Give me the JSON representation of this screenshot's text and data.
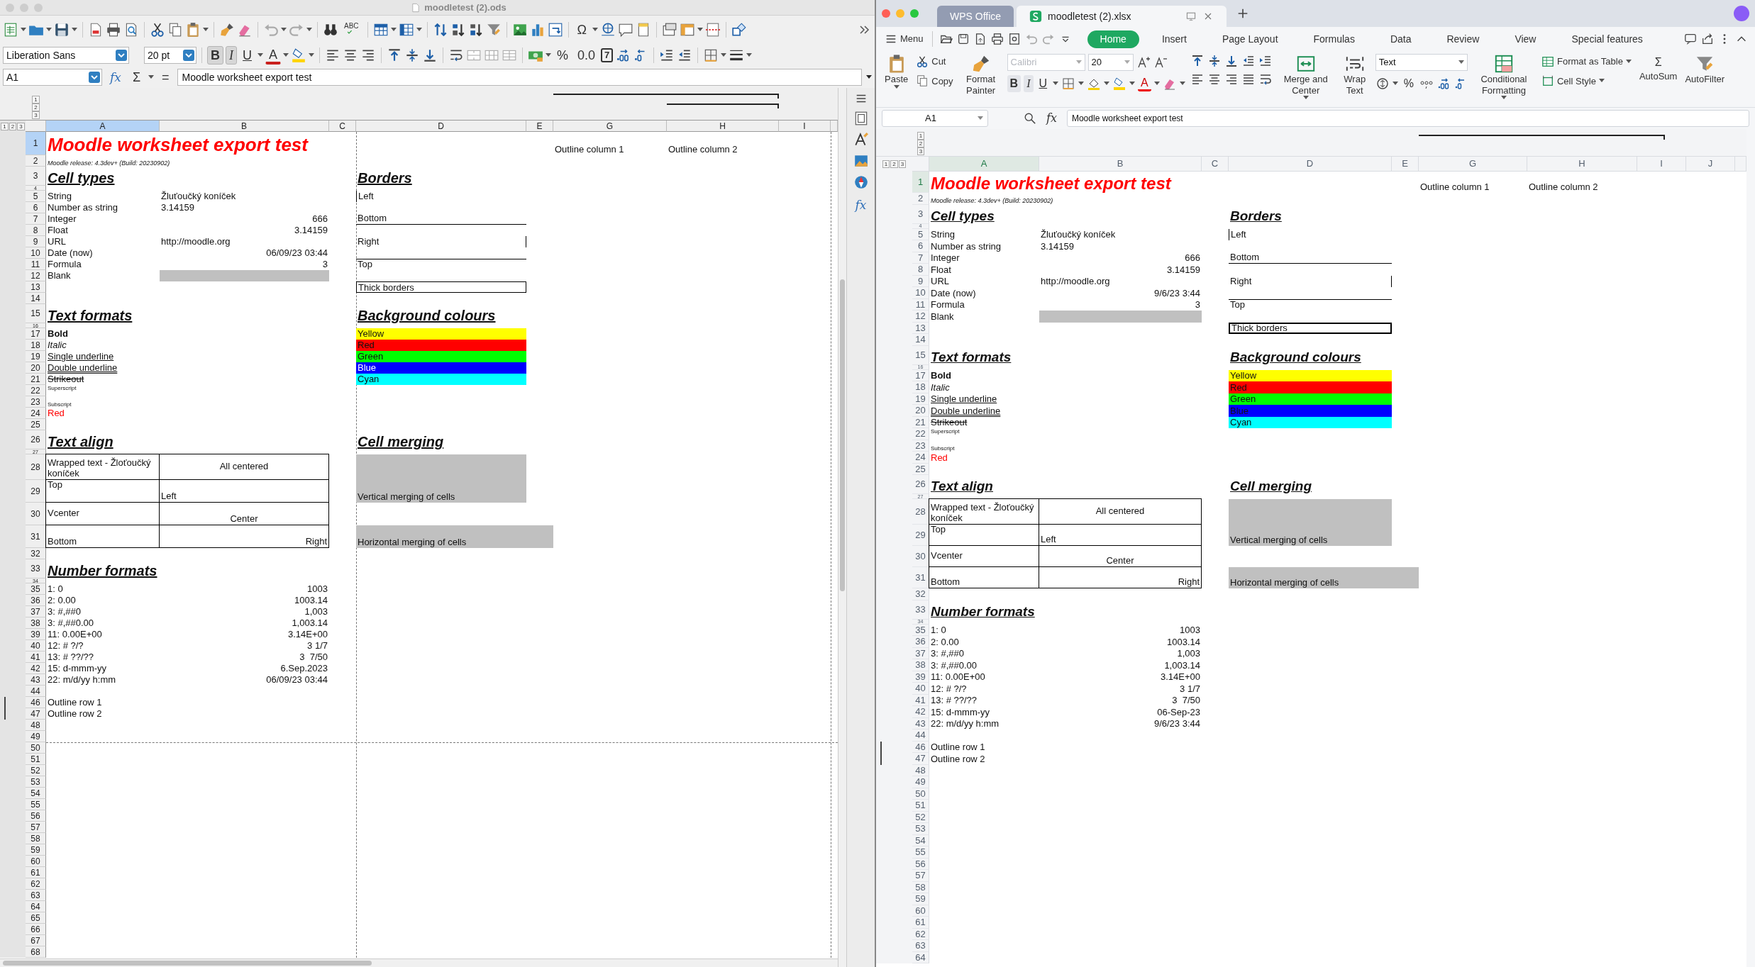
{
  "panes": [
    {
      "kind": "libreoffice",
      "title": "moodletest (2).ods",
      "glyphs": {
        "spelling": "ABC",
        "special_char": "Ω",
        "font_color": "A",
        "percent": "%",
        "number": "0.0",
        "calendar": "7"
      },
      "font_name": "Liberation Sans",
      "font_size": "20 pt",
      "format_buttons": [
        {
          "kind": "bold",
          "label": "B",
          "active": true
        },
        {
          "kind": "italic",
          "label": "I",
          "active": true
        },
        {
          "kind": "underline",
          "label": "U",
          "active": false
        }
      ],
      "name_box": "A1",
      "formula_symbols": [
        "fx",
        "Σ",
        "="
      ],
      "formula": "Moodle worksheet export test",
      "sidebar_fx": "fx",
      "outline_levels": [
        "1",
        "2",
        "3"
      ],
      "row_outline_levels": [
        "1",
        "2",
        "3"
      ],
      "columns": [
        {
          "label": "A",
          "selected": true
        },
        {
          "label": "B",
          "selected": false
        },
        {
          "label": "C",
          "selected": false
        },
        {
          "label": "D",
          "selected": false
        },
        {
          "label": "E",
          "selected": false
        },
        {
          "label": "G",
          "selected": false
        },
        {
          "label": "H",
          "selected": false
        },
        {
          "label": "I",
          "selected": false
        }
      ],
      "rows": [
        {
          "label": "1",
          "selected": true,
          "grouped": false,
          "page_break": false,
          "cells": {
            "col_a": {
              "kind": "title",
              "text": "Moodle worksheet export test"
            },
            "col_g": {
              "kind": "text",
              "text": "Outline column 1"
            },
            "col_h": {
              "kind": "text",
              "text": "Outline column 2"
            }
          }
        },
        {
          "label": "2",
          "selected": false,
          "grouped": false,
          "page_break": false,
          "cells": {
            "col_a": {
              "kind": "note",
              "text": "Moodle release: 4.3dev+ (Build: 20230902)"
            }
          }
        },
        {
          "label": "3",
          "selected": false,
          "grouped": false,
          "page_break": false,
          "cells": {
            "col_a": {
              "kind": "heading",
              "text": "Cell types"
            },
            "col_d": {
              "kind": "heading",
              "text": "Borders"
            }
          }
        },
        {
          "label": "4",
          "selected": false,
          "grouped": false,
          "page_break": false
        },
        {
          "label": "5",
          "selected": false,
          "grouped": false,
          "page_break": false,
          "cells": {
            "col_a": {
              "kind": "text",
              "text": "String"
            },
            "col_b": {
              "kind": "text",
              "text": "Žluťoučký koníček"
            },
            "col_d": {
              "kind": "border_left",
              "text": "Left"
            }
          }
        },
        {
          "label": "6",
          "selected": false,
          "grouped": false,
          "page_break": false,
          "cells": {
            "col_a": {
              "kind": "text",
              "text": "Number as string"
            },
            "col_b": {
              "kind": "text",
              "text": "3.14159"
            }
          }
        },
        {
          "label": "7",
          "selected": false,
          "grouped": false,
          "page_break": false,
          "cells": {
            "col_a": {
              "kind": "text",
              "text": "Integer"
            },
            "col_b": {
              "kind": "number",
              "text": "666"
            },
            "col_d": {
              "kind": "border_bottom",
              "text": "Bottom"
            }
          }
        },
        {
          "label": "8",
          "selected": false,
          "grouped": false,
          "page_break": false,
          "cells": {
            "col_a": {
              "kind": "text",
              "text": "Float"
            },
            "col_b": {
              "kind": "number",
              "text": "3.14159"
            }
          }
        },
        {
          "label": "9",
          "selected": false,
          "grouped": false,
          "page_break": false,
          "cells": {
            "col_a": {
              "kind": "text",
              "text": "URL"
            },
            "col_b": {
              "kind": "text",
              "text": "http://moodle.org"
            },
            "col_d": {
              "kind": "border_right",
              "text": "Right"
            }
          }
        },
        {
          "label": "10",
          "selected": false,
          "grouped": false,
          "page_break": false,
          "cells": {
            "col_a": {
              "kind": "text",
              "text": "Date (now)"
            },
            "col_b": {
              "kind": "number",
              "text": "06/09/23 03:44"
            }
          }
        },
        {
          "label": "11",
          "selected": false,
          "grouped": false,
          "page_break": false,
          "cells": {
            "col_a": {
              "kind": "text",
              "text": "Formula"
            },
            "col_b": {
              "kind": "number",
              "text": "3"
            },
            "col_d": {
              "kind": "border_top",
              "text": "Top"
            }
          }
        },
        {
          "label": "12",
          "selected": false,
          "grouped": false,
          "page_break": false,
          "cells": {
            "col_a": {
              "kind": "text",
              "text": "Blank"
            },
            "col_b": {
              "kind": "fill",
              "color": "#c0c0c0"
            }
          }
        },
        {
          "label": "13",
          "selected": false,
          "grouped": false,
          "page_break": false,
          "cells": {
            "col_d": {
              "kind": "border_box",
              "text": "Thick borders"
            }
          }
        },
        {
          "label": "14",
          "selected": false,
          "grouped": false,
          "page_break": false
        },
        {
          "label": "15",
          "selected": false,
          "grouped": false,
          "page_break": false,
          "cells": {
            "col_a": {
              "kind": "heading",
              "text": "Text formats"
            },
            "col_d": {
              "kind": "heading",
              "text": "Background colours"
            }
          }
        },
        {
          "label": "16",
          "selected": false,
          "grouped": false,
          "page_break": false
        },
        {
          "label": "17",
          "selected": false,
          "grouped": false,
          "page_break": false,
          "cells": {
            "col_a": {
              "kind": "bold",
              "text": "Bold"
            },
            "col_d": {
              "kind": "fill",
              "text": "Yellow",
              "color": "#ffff00"
            }
          }
        },
        {
          "label": "18",
          "selected": false,
          "grouped": false,
          "page_break": false,
          "cells": {
            "col_a": {
              "kind": "italic",
              "text": "Italic"
            },
            "col_d": {
              "kind": "fill",
              "text": "Red",
              "color": "#ff0000"
            }
          }
        },
        {
          "label": "19",
          "selected": false,
          "grouped": false,
          "page_break": false,
          "cells": {
            "col_a": {
              "kind": "underline",
              "text": "Single underline"
            },
            "col_d": {
              "kind": "fill",
              "text": "Green",
              "color": "#00ff00"
            }
          }
        },
        {
          "label": "20",
          "selected": false,
          "grouped": false,
          "page_break": false,
          "cells": {
            "col_a": {
              "kind": "double_underline",
              "text": "Double underline"
            },
            "col_d": {
              "kind": "fill_inverse",
              "text": "Blue",
              "color": "#0000ff"
            }
          }
        },
        {
          "label": "21",
          "selected": false,
          "grouped": false,
          "page_break": false,
          "cells": {
            "col_a": {
              "kind": "strike",
              "text": "Strikeout"
            },
            "col_d": {
              "kind": "fill",
              "text": "Cyan",
              "color": "#00ffff"
            }
          }
        },
        {
          "label": "22",
          "selected": false,
          "grouped": false,
          "page_break": false,
          "cells": {
            "col_a": {
              "kind": "superscript",
              "text": "Superscript"
            }
          }
        },
        {
          "label": "23",
          "selected": false,
          "grouped": false,
          "page_break": false,
          "cells": {
            "col_a": {
              "kind": "subscript",
              "text": "Subscript"
            }
          }
        },
        {
          "label": "24",
          "selected": false,
          "grouped": false,
          "page_break": false,
          "cells": {
            "col_a": {
              "kind": "red",
              "text": "Red"
            }
          }
        },
        {
          "label": "25",
          "selected": false,
          "grouped": false,
          "page_break": false
        },
        {
          "label": "26",
          "selected": false,
          "grouped": false,
          "page_break": false,
          "cells": {
            "col_a": {
              "kind": "heading",
              "text": "Text align"
            },
            "col_d": {
              "kind": "heading",
              "text": "Cell merging"
            }
          }
        },
        {
          "label": "27",
          "selected": false,
          "grouped": false,
          "page_break": false
        },
        {
          "label": "28",
          "selected": false,
          "grouped": false,
          "page_break": false,
          "cells": {
            "col_a": {
              "kind": "table_wrap",
              "text": "Wrapped text - Žloťoučký koníček"
            },
            "col_b": {
              "kind": "table_center_middle",
              "text": "All centered"
            },
            "col_d": {
              "kind": "merge_down",
              "text": "Vertical merging of cells",
              "color": "#c0c0c0"
            }
          }
        },
        {
          "label": "29",
          "selected": false,
          "grouped": false,
          "page_break": false,
          "cells": {
            "col_a": {
              "kind": "table_top",
              "text": "Top"
            },
            "col_b": {
              "kind": "table_bottom",
              "text": "Left"
            }
          }
        },
        {
          "label": "30",
          "selected": false,
          "grouped": false,
          "page_break": false,
          "cells": {
            "col_a": {
              "kind": "table_middle",
              "text": "Vcenter"
            },
            "col_b": {
              "kind": "table_center",
              "text": "Center"
            }
          }
        },
        {
          "label": "31",
          "selected": false,
          "grouped": false,
          "page_break": false,
          "cells": {
            "col_a": {
              "kind": "table_bottom",
              "text": "Bottom"
            },
            "col_b": {
              "kind": "table_right",
              "text": "Right"
            },
            "col_d": {
              "kind": "merge_across",
              "text": "Horizontal merging of cells",
              "color": "#c0c0c0"
            }
          }
        },
        {
          "label": "32",
          "selected": false,
          "grouped": false,
          "page_break": false
        },
        {
          "label": "33",
          "selected": false,
          "grouped": false,
          "page_break": false,
          "cells": {
            "col_a": {
              "kind": "heading",
              "text": "Number formats"
            }
          }
        },
        {
          "label": "34",
          "selected": false,
          "grouped": false,
          "page_break": false
        },
        {
          "label": "35",
          "selected": false,
          "grouped": false,
          "page_break": false,
          "cells": {
            "col_a": {
              "kind": "text",
              "text": "1: 0"
            },
            "col_b": {
              "kind": "number",
              "text": "1003"
            }
          }
        },
        {
          "label": "36",
          "selected": false,
          "grouped": false,
          "page_break": false,
          "cells": {
            "col_a": {
              "kind": "text",
              "text": "2: 0.00"
            },
            "col_b": {
              "kind": "number",
              "text": "1003.14"
            }
          }
        },
        {
          "label": "37",
          "selected": false,
          "grouped": false,
          "page_break": false,
          "cells": {
            "col_a": {
              "kind": "text",
              "text": "3: #,##0"
            },
            "col_b": {
              "kind": "number",
              "text": "1,003"
            }
          }
        },
        {
          "label": "38",
          "selected": false,
          "grouped": false,
          "page_break": false,
          "cells": {
            "col_a": {
              "kind": "text",
              "text": "3: #,##0.00"
            },
            "col_b": {
              "kind": "number",
              "text": "1,003.14"
            }
          }
        },
        {
          "label": "39",
          "selected": false,
          "grouped": false,
          "page_break": false,
          "cells": {
            "col_a": {
              "kind": "text",
              "text": "11: 0.00E+00"
            },
            "col_b": {
              "kind": "number",
              "text": "3.14E+00"
            }
          }
        },
        {
          "label": "40",
          "selected": false,
          "grouped": false,
          "page_break": false,
          "cells": {
            "col_a": {
              "kind": "text",
              "text": "12: # ?/?"
            },
            "col_b": {
              "kind": "number",
              "text": "3 1/7"
            }
          }
        },
        {
          "label": "41",
          "selected": false,
          "grouped": false,
          "page_break": false,
          "cells": {
            "col_a": {
              "kind": "text",
              "text": "13: # ??/??"
            },
            "col_b": {
              "kind": "number",
              "text": "3  7/50"
            }
          }
        },
        {
          "label": "42",
          "selected": false,
          "grouped": false,
          "page_break": false,
          "cells": {
            "col_a": {
              "kind": "text",
              "text": "15: d-mmm-yy"
            },
            "col_b": {
              "kind": "number",
              "text": "6.Sep.2023"
            }
          }
        },
        {
          "label": "43",
          "selected": false,
          "grouped": false,
          "page_break": false,
          "cells": {
            "col_a": {
              "kind": "text",
              "text": "22: m/d/yy h:mm"
            },
            "col_b": {
              "kind": "number",
              "text": "06/09/23 03:44"
            }
          }
        },
        {
          "label": "44",
          "selected": false,
          "grouped": false,
          "page_break": false
        },
        {
          "label": "46",
          "selected": false,
          "grouped": true,
          "page_break": false,
          "cells": {
            "col_a": {
              "kind": "text",
              "text": "Outline row 1"
            }
          }
        },
        {
          "label": "47",
          "selected": false,
          "grouped": true,
          "page_break": false,
          "cells": {
            "col_a": {
              "kind": "text",
              "text": "Outline row 2"
            }
          }
        },
        {
          "label": "48",
          "selected": false,
          "grouped": false,
          "page_break": false
        },
        {
          "label": "49",
          "selected": false,
          "grouped": false,
          "page_break": false
        },
        {
          "label": "50",
          "selected": false,
          "grouped": false,
          "page_break": true
        },
        {
          "label": "51",
          "selected": false,
          "grouped": false,
          "page_break": false
        },
        {
          "label": "52",
          "selected": false,
          "grouped": false,
          "page_break": false
        },
        {
          "label": "53",
          "selected": false,
          "grouped": false,
          "page_break": false
        },
        {
          "label": "54",
          "selected": false,
          "grouped": false,
          "page_break": false
        },
        {
          "label": "55",
          "selected": false,
          "grouped": false,
          "page_break": false
        },
        {
          "label": "56",
          "selected": false,
          "grouped": false,
          "page_break": false
        },
        {
          "label": "57",
          "selected": false,
          "grouped": false,
          "page_break": false
        },
        {
          "label": "58",
          "selected": false,
          "grouped": false,
          "page_break": false
        },
        {
          "label": "59",
          "selected": false,
          "grouped": false,
          "page_break": false
        },
        {
          "label": "60",
          "selected": false,
          "grouped": false,
          "page_break": false
        },
        {
          "label": "61",
          "selected": false,
          "grouped": false,
          "page_break": false
        },
        {
          "label": "62",
          "selected": false,
          "grouped": false,
          "page_break": false
        },
        {
          "label": "63",
          "selected": false,
          "grouped": false,
          "page_break": false
        },
        {
          "label": "64",
          "selected": false,
          "grouped": false,
          "page_break": false
        },
        {
          "label": "65",
          "selected": false,
          "grouped": false,
          "page_break": false
        },
        {
          "label": "66",
          "selected": false,
          "grouped": false,
          "page_break": false
        },
        {
          "label": "67",
          "selected": false,
          "grouped": false,
          "page_break": false
        },
        {
          "label": "68",
          "selected": false,
          "grouped": false,
          "page_break": false
        }
      ]
    },
    {
      "kind": "wps",
      "tabs": [
        {
          "label": "WPS Office",
          "selected": false
        },
        {
          "label": "moodletest (2).xlsx",
          "selected": true
        }
      ],
      "menu": "Menu",
      "ribbon_tabs": [
        {
          "label": "Home",
          "selected": true
        },
        {
          "label": "Insert",
          "selected": false
        },
        {
          "label": "Page Layout",
          "selected": false
        },
        {
          "label": "Formulas",
          "selected": false
        },
        {
          "label": "Data",
          "selected": false
        },
        {
          "label": "Review",
          "selected": false
        },
        {
          "label": "View",
          "selected": false
        },
        {
          "label": "Special features",
          "selected": false
        }
      ],
      "ribbon": {
        "paste": "Paste",
        "cut": "Cut",
        "copy": "Copy",
        "format_painter": "Format Painter",
        "merge": "Merge and Center",
        "wrap": "Wrap Text",
        "conditional": "Conditional Formatting",
        "format_table": "Format as Table",
        "cell_style": "Cell Style",
        "autosum": "AutoSum",
        "autofilter": "AutoFilter"
      },
      "font_name": {
        "value": "Calibri",
        "disabled": true
      },
      "font_size": "20",
      "format_buttons": [
        {
          "kind": "bold",
          "label": "B",
          "active": true
        },
        {
          "kind": "italic",
          "label": "I",
          "active": true
        },
        {
          "kind": "underline",
          "label": "U",
          "active": false
        }
      ],
      "glyphs": {
        "font_color": "A",
        "percent": "%",
        "sum": "Σ"
      },
      "number_format": "Text",
      "name_box": "A1",
      "formula_symbols": [
        "fx"
      ],
      "formula": "Moodle worksheet export test",
      "outline_levels": [
        "1",
        "2",
        "3"
      ],
      "row_outline_levels": [
        "1",
        "2",
        "3"
      ],
      "columns": [
        {
          "label": "A",
          "selected": true
        },
        {
          "label": "B",
          "selected": false
        },
        {
          "label": "C",
          "selected": false
        },
        {
          "label": "D",
          "selected": false
        },
        {
          "label": "E",
          "selected": false
        },
        {
          "label": "G",
          "selected": false
        },
        {
          "label": "H",
          "selected": false
        },
        {
          "label": "I",
          "selected": false
        },
        {
          "label": "J",
          "selected": false
        }
      ],
      "rows": [
        {
          "label": "1",
          "selected": true,
          "grouped": false,
          "cells": {
            "col_a": {
              "kind": "title",
              "text": "Moodle worksheet export test"
            },
            "col_g": {
              "kind": "text",
              "text": "Outline column 1"
            },
            "col_h": {
              "kind": "text",
              "text": "Outline column 2"
            }
          }
        },
        {
          "label": "2",
          "selected": false,
          "grouped": false,
          "cells": {
            "col_a": {
              "kind": "note",
              "text": "Moodle release: 4.3dev+ (Build: 20230902)"
            }
          }
        },
        {
          "label": "3",
          "selected": false,
          "grouped": false,
          "cells": {
            "col_a": {
              "kind": "heading",
              "text": "Cell types"
            },
            "col_d": {
              "kind": "heading",
              "text": "Borders"
            }
          }
        },
        {
          "label": "4",
          "selected": false,
          "grouped": false
        },
        {
          "label": "5",
          "selected": false,
          "grouped": false,
          "cells": {
            "col_a": {
              "kind": "text",
              "text": "String"
            },
            "col_b": {
              "kind": "text",
              "text": "Žluťoučký koníček"
            },
            "col_d": {
              "kind": "border_left",
              "text": "Left"
            }
          }
        },
        {
          "label": "6",
          "selected": false,
          "grouped": false,
          "cells": {
            "col_a": {
              "kind": "text",
              "text": "Number as string"
            },
            "col_b": {
              "kind": "text",
              "text": "3.14159"
            }
          }
        },
        {
          "label": "7",
          "selected": false,
          "grouped": false,
          "cells": {
            "col_a": {
              "kind": "text",
              "text": "Integer"
            },
            "col_b": {
              "kind": "number",
              "text": "666"
            },
            "col_d": {
              "kind": "border_bottom",
              "text": "Bottom"
            }
          }
        },
        {
          "label": "8",
          "selected": false,
          "grouped": false,
          "cells": {
            "col_a": {
              "kind": "text",
              "text": "Float"
            },
            "col_b": {
              "kind": "number",
              "text": "3.14159"
            }
          }
        },
        {
          "label": "9",
          "selected": false,
          "grouped": false,
          "cells": {
            "col_a": {
              "kind": "text",
              "text": "URL"
            },
            "col_b": {
              "kind": "text",
              "text": "http://moodle.org"
            },
            "col_d": {
              "kind": "border_right",
              "text": "Right"
            }
          }
        },
        {
          "label": "10",
          "selected": false,
          "grouped": false,
          "cells": {
            "col_a": {
              "kind": "text",
              "text": "Date (now)"
            },
            "col_b": {
              "kind": "number",
              "text": "9/6/23 3:44"
            }
          }
        },
        {
          "label": "11",
          "selected": false,
          "grouped": false,
          "cells": {
            "col_a": {
              "kind": "text",
              "text": "Formula"
            },
            "col_b": {
              "kind": "number",
              "text": "3"
            },
            "col_d": {
              "kind": "border_top",
              "text": "Top"
            }
          }
        },
        {
          "label": "12",
          "selected": false,
          "grouped": false,
          "cells": {
            "col_a": {
              "kind": "text",
              "text": "Blank"
            },
            "col_b": {
              "kind": "fill",
              "color": "#c0c0c0"
            }
          }
        },
        {
          "label": "13",
          "selected": false,
          "grouped": false,
          "cells": {
            "col_d": {
              "kind": "border_thick",
              "text": "Thick borders"
            }
          }
        },
        {
          "label": "14",
          "selected": false,
          "grouped": false
        },
        {
          "label": "15",
          "selected": false,
          "grouped": false,
          "cells": {
            "col_a": {
              "kind": "heading",
              "text": "Text formats"
            },
            "col_d": {
              "kind": "heading",
              "text": "Background colours"
            }
          }
        },
        {
          "label": "16",
          "selected": false,
          "grouped": false
        },
        {
          "label": "17",
          "selected": false,
          "grouped": false,
          "cells": {
            "col_a": {
              "kind": "bold",
              "text": "Bold"
            },
            "col_d": {
              "kind": "fill",
              "text": "Yellow",
              "color": "#ffff00"
            }
          }
        },
        {
          "label": "18",
          "selected": false,
          "grouped": false,
          "cells": {
            "col_a": {
              "kind": "italic",
              "text": "Italic"
            },
            "col_d": {
              "kind": "fill",
              "text": "Red",
              "color": "#ff0000"
            }
          }
        },
        {
          "label": "19",
          "selected": false,
          "grouped": false,
          "cells": {
            "col_a": {
              "kind": "underline",
              "text": "Single underline"
            },
            "col_d": {
              "kind": "fill",
              "text": "Green",
              "color": "#00ff00"
            }
          }
        },
        {
          "label": "20",
          "selected": false,
          "grouped": false,
          "cells": {
            "col_a": {
              "kind": "double_underline",
              "text": "Double underline"
            },
            "col_d": {
              "kind": "fill",
              "text": "Blue",
              "color": "#0000ff"
            }
          }
        },
        {
          "label": "21",
          "selected": false,
          "grouped": false,
          "cells": {
            "col_a": {
              "kind": "strike",
              "text": "Strikeout"
            },
            "col_d": {
              "kind": "fill",
              "text": "Cyan",
              "color": "#00ffff"
            }
          }
        },
        {
          "label": "22",
          "selected": false,
          "grouped": false,
          "cells": {
            "col_a": {
              "kind": "superscript",
              "text": "Superscript"
            }
          }
        },
        {
          "label": "23",
          "selected": false,
          "grouped": false,
          "cells": {
            "col_a": {
              "kind": "subscript",
              "text": "Subscript"
            }
          }
        },
        {
          "label": "24",
          "selected": false,
          "grouped": false,
          "cells": {
            "col_a": {
              "kind": "red",
              "text": "Red"
            }
          }
        },
        {
          "label": "25",
          "selected": false,
          "grouped": false
        },
        {
          "label": "26",
          "selected": false,
          "grouped": false,
          "cells": {
            "col_a": {
              "kind": "heading",
              "text": "Text align"
            },
            "col_d": {
              "kind": "heading",
              "text": "Cell merging"
            }
          }
        },
        {
          "label": "27",
          "selected": false,
          "grouped": false
        },
        {
          "label": "28",
          "selected": false,
          "grouped": false,
          "cells": {
            "col_a": {
              "kind": "table_wrap",
              "text": "Wrapped text - Žloťoučký koníček"
            },
            "col_b": {
              "kind": "table_center_middle",
              "text": "All centered"
            },
            "col_d": {
              "kind": "merge_down",
              "text": "Vertical merging of cells",
              "color": "#c0c0c0"
            }
          }
        },
        {
          "label": "29",
          "selected": false,
          "grouped": false,
          "cells": {
            "col_a": {
              "kind": "table_top",
              "text": "Top"
            },
            "col_b": {
              "kind": "table_bottom",
              "text": "Left"
            }
          }
        },
        {
          "label": "30",
          "selected": false,
          "grouped": false,
          "cells": {
            "col_a": {
              "kind": "table_middle",
              "text": "Vcenter"
            },
            "col_b": {
              "kind": "table_center",
              "text": "Center"
            }
          }
        },
        {
          "label": "31",
          "selected": false,
          "grouped": false,
          "cells": {
            "col_a": {
              "kind": "table_bottom",
              "text": "Bottom"
            },
            "col_b": {
              "kind": "table_right",
              "text": "Right"
            },
            "col_d": {
              "kind": "merge_across",
              "text": "Horizontal merging of cells",
              "color": "#c0c0c0"
            }
          }
        },
        {
          "label": "32",
          "selected": false,
          "grouped": false
        },
        {
          "label": "33",
          "selected": false,
          "grouped": false,
          "cells": {
            "col_a": {
              "kind": "heading",
              "text": "Number formats"
            }
          }
        },
        {
          "label": "34",
          "selected": false,
          "grouped": false
        },
        {
          "label": "35",
          "selected": false,
          "grouped": false,
          "cells": {
            "col_a": {
              "kind": "text",
              "text": "1: 0"
            },
            "col_b": {
              "kind": "number",
              "text": "1003"
            }
          }
        },
        {
          "label": "36",
          "selected": false,
          "grouped": false,
          "cells": {
            "col_a": {
              "kind": "text",
              "text": "2: 0.00"
            },
            "col_b": {
              "kind": "number",
              "text": "1003.14"
            }
          }
        },
        {
          "label": "37",
          "selected": false,
          "grouped": false,
          "cells": {
            "col_a": {
              "kind": "text",
              "text": "3: #,##0"
            },
            "col_b": {
              "kind": "number",
              "text": "1,003"
            }
          }
        },
        {
          "label": "38",
          "selected": false,
          "grouped": false,
          "cells": {
            "col_a": {
              "kind": "text",
              "text": "3: #,##0.00"
            },
            "col_b": {
              "kind": "number",
              "text": "1,003.14"
            }
          }
        },
        {
          "label": "39",
          "selected": false,
          "grouped": false,
          "cells": {
            "col_a": {
              "kind": "text",
              "text": "11: 0.00E+00"
            },
            "col_b": {
              "kind": "number",
              "text": "3.14E+00"
            }
          }
        },
        {
          "label": "40",
          "selected": false,
          "grouped": false,
          "cells": {
            "col_a": {
              "kind": "text",
              "text": "12: # ?/?"
            },
            "col_b": {
              "kind": "number",
              "text": "3 1/7"
            }
          }
        },
        {
          "label": "41",
          "selected": false,
          "grouped": false,
          "cells": {
            "col_a": {
              "kind": "text",
              "text": "13: # ??/??"
            },
            "col_b": {
              "kind": "number",
              "text": "3  7/50"
            }
          }
        },
        {
          "label": "42",
          "selected": false,
          "grouped": false,
          "cells": {
            "col_a": {
              "kind": "text",
              "text": "15: d-mmm-yy"
            },
            "col_b": {
              "kind": "number",
              "text": "06-Sep-23"
            }
          }
        },
        {
          "label": "43",
          "selected": false,
          "grouped": false,
          "cells": {
            "col_a": {
              "kind": "text",
              "text": "22: m/d/yy h:mm"
            },
            "col_b": {
              "kind": "number",
              "text": "9/6/23 3:44"
            }
          }
        },
        {
          "label": "44",
          "selected": false,
          "grouped": false
        },
        {
          "label": "46",
          "selected": false,
          "grouped": true,
          "cells": {
            "col_a": {
              "kind": "text",
              "text": "Outline row 1"
            }
          }
        },
        {
          "label": "47",
          "selected": false,
          "grouped": true,
          "cells": {
            "col_a": {
              "kind": "text",
              "text": "Outline row 2"
            }
          }
        },
        {
          "label": "48",
          "selected": false,
          "grouped": false
        },
        {
          "label": "49",
          "selected": false,
          "grouped": false
        },
        {
          "label": "50",
          "selected": false,
          "grouped": false
        },
        {
          "label": "51",
          "selected": false,
          "grouped": false
        },
        {
          "label": "52",
          "selected": false,
          "grouped": false
        },
        {
          "label": "53",
          "selected": false,
          "grouped": false
        },
        {
          "label": "54",
          "selected": false,
          "grouped": false
        },
        {
          "label": "55",
          "selected": false,
          "grouped": false
        },
        {
          "label": "56",
          "selected": false,
          "grouped": false
        },
        {
          "label": "57",
          "selected": false,
          "grouped": false
        },
        {
          "label": "58",
          "selected": false,
          "grouped": false
        },
        {
          "label": "59",
          "selected": false,
          "grouped": false
        },
        {
          "label": "60",
          "selected": false,
          "grouped": false
        },
        {
          "label": "61",
          "selected": false,
          "grouped": false
        },
        {
          "label": "62",
          "selected": false,
          "grouped": false
        },
        {
          "label": "63",
          "selected": false,
          "grouped": false
        },
        {
          "label": "64",
          "selected": false,
          "grouped": false
        }
      ]
    }
  ]
}
